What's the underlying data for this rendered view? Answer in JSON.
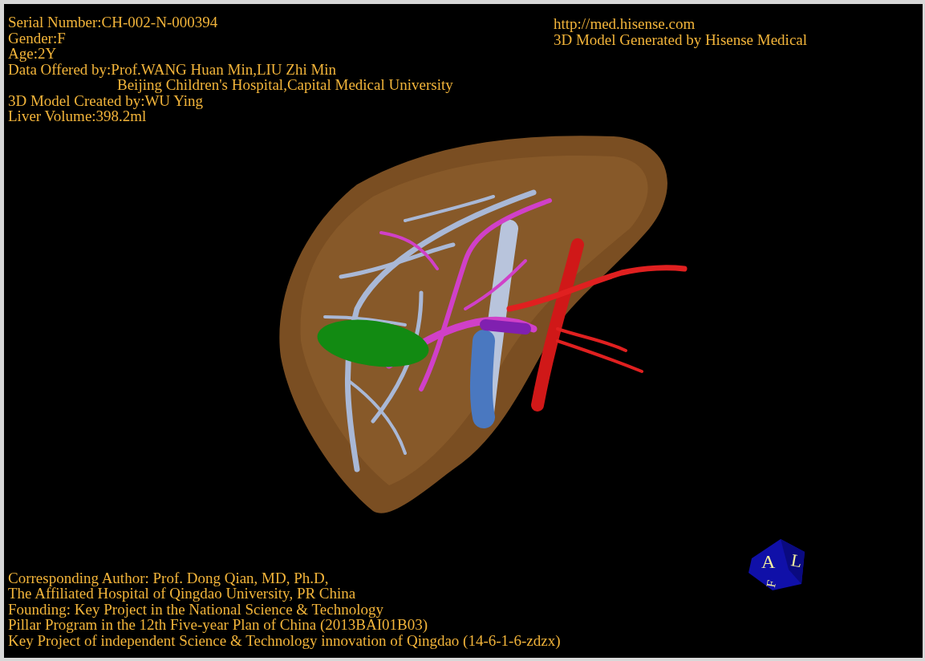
{
  "header_left": [
    {
      "kind": "line",
      "text": "Serial Number:CH-002-N-000394"
    },
    {
      "kind": "line",
      "text": "Gender:F"
    },
    {
      "kind": "line",
      "text": "Age:2Y"
    },
    {
      "kind": "line",
      "text": "Data Offered by:Prof.WANG Huan Min,LIU Zhi Min"
    },
    {
      "kind": "continuation",
      "text": "Beijing Children's Hospital,Capital Medical University"
    },
    {
      "kind": "line",
      "text": "3D Model Created by:WU Ying"
    },
    {
      "kind": "line",
      "text": "Liver Volume:398.2ml"
    }
  ],
  "header_right": [
    "http://med.hisense.com",
    "3D Model Generated by Hisense Medical"
  ],
  "footer": [
    "Corresponding Author: Prof. Dong Qian, MD, Ph.D,",
    "The Affiliated Hospital of Qingdao University, PR China",
    "Founding: Key Project in the National Science & Technology",
    "Pillar Program in the 12th Five-year Plan of China (2013BAI01B03)",
    "Key Project of independent Science & Technology innovation of Qingdao (14-6-1-6-zdzx)"
  ],
  "orientation_cube": {
    "front": "A",
    "side": "L",
    "bottom": "F"
  }
}
